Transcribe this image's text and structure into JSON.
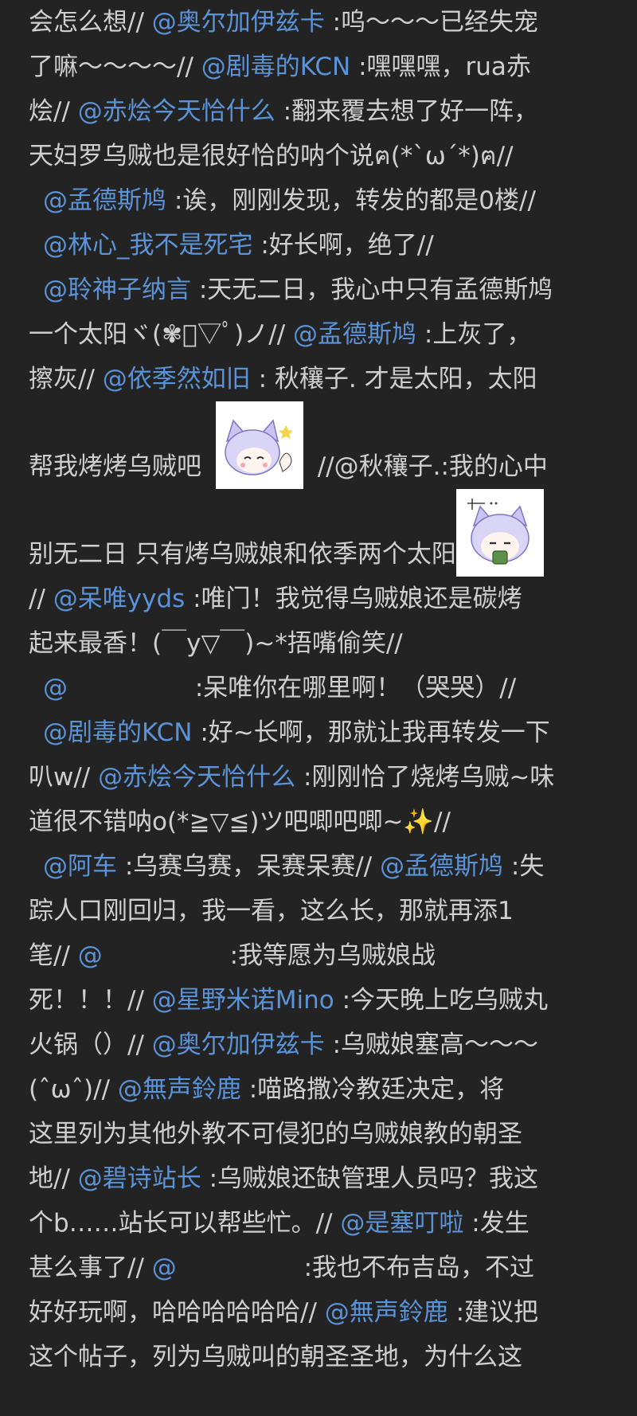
{
  "colors": {
    "background": "#232323",
    "text": "#cfcfcf",
    "mention": "#5b93d8"
  },
  "lines": [
    {
      "t1": "会怎么想// ",
      "m1": "@奥尔加伊兹卡",
      "t2": " :呜～～～已经失宠"
    },
    {
      "t1": "了嘛～～～～// ",
      "m1": "@剧毒的KCN",
      "t2": " :嘿嘿嘿，rua赤"
    },
    {
      "t1": "烩// ",
      "m1": "@赤烩今天恰什么",
      "t2": " :翻来覆去想了好一阵，"
    },
    {
      "t1": "天妇罗乌贼也是很好恰的呐个说ฅ(*`ω´*)ฅ//"
    },
    {
      "m1": "@孟德斯鸠",
      "t2": " :诶，刚刚发现，转发的都是0楼//"
    },
    {
      "m1": "@林心_我不是死宅",
      "t2": " :好长啊，绝了//"
    },
    {
      "m1": "@聆神子纳言",
      "t2": " :天无二日，我心中只有孟德斯鸠"
    },
    {
      "t1": "一个太阳ヾ(✾ﾟ▽ﾟ)ノ// ",
      "m1": "@孟德斯鸠",
      "t2": " :上灰了，"
    },
    {
      "t1": "擦灰// ",
      "m1": "@依季然如旧",
      "t2": " : 秋穰子. 才是太阳，太阳"
    },
    {
      "t1": "帮我烤烤乌贼吧",
      "t2": "//@秋穰子.:我的心中"
    },
    {
      "t1": "别无二日 只有烤乌贼娘和依季两个太阳"
    },
    {
      "t1": "// ",
      "m1": "@呆唯yyds",
      "t2": " :唯门！我觉得乌贼娘还是碳烤"
    },
    {
      "t1": "起来最香！(￣y▽￣)~*捂嘴偷笑//"
    },
    {
      "m1": "@",
      "t2": " :呆唯你在哪里啊！（哭哭）//"
    },
    {
      "m1": "@剧毒的KCN",
      "t2": " :好~长啊，那就让我再转发一下"
    },
    {
      "t1": "叭w// ",
      "m1": "@赤烩今天恰什么",
      "t2": " :刚刚恰了烧烤乌贼~味"
    },
    {
      "t1": "道很不错呐o(*≧▽≦)ツ吧唧吧唧~✨//"
    },
    {
      "m1": "@阿车",
      "t2": " :乌赛乌赛，呆赛呆赛// ",
      "m2": "@孟德斯鸠",
      "t3": " :失"
    },
    {
      "t1": "踪人口刚回归，我一看，这么长，那就再添1"
    },
    {
      "t1": "笔// ",
      "m1": "@",
      "t2": " :我等愿为乌贼娘战"
    },
    {
      "t1": "死！！！// ",
      "m1": "@星野米诺Mino",
      "t2": " :今天晚上吃乌贼丸"
    },
    {
      "t1": "火锅（）// ",
      "m1": "@奥尔加伊兹卡",
      "t2": " :乌贼娘塞高～～～"
    },
    {
      "t1": "(ˆωˆ)// ",
      "m1": "@無声鈴鹿",
      "t2": " :喵路撒冷教廷决定，将"
    },
    {
      "t1": "这里列为其他外教不可侵犯的乌贼娘教的朝圣"
    },
    {
      "t1": "地// ",
      "m1": "@碧诗站长",
      "t2": " :乌贼娘还缺管理人员吗？我这"
    },
    {
      "t1": "个b……站长可以帮些忙。// ",
      "m1": "@是塞叮啦",
      "t2": " :发生"
    },
    {
      "t1": "甚么事了// ",
      "m1": "@",
      "t2": " :我也不布吉岛，不过"
    },
    {
      "t1": "好好玩啊，哈哈哈哈哈哈// ",
      "m1": "@無声鈴鹿",
      "t2": " :建议把"
    },
    {
      "t1": "这个帖子，列为乌贼叫的朝圣圣地，为什么这"
    }
  ]
}
